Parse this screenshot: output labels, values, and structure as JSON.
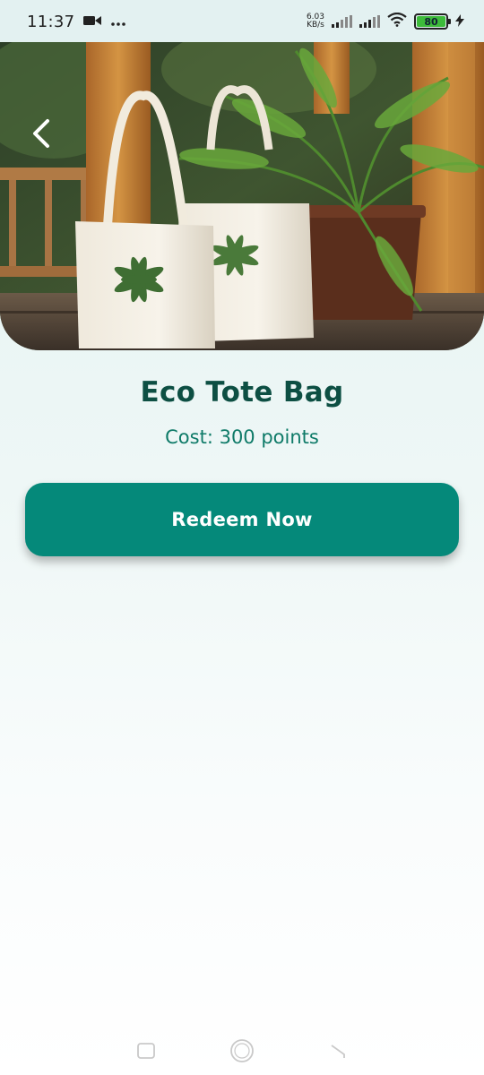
{
  "status_bar": {
    "time": "11:37",
    "net_speed_value": "6.03",
    "net_speed_unit": "KB/s",
    "battery_level": "80",
    "icons": [
      "video-camera-icon",
      "more-dots-icon",
      "signal-icon",
      "signal-icon",
      "wifi-icon",
      "battery-icon",
      "charging-icon"
    ]
  },
  "hero": {
    "image_subject": "eco-tote-bag-photo",
    "back_icon": "chevron-left-icon"
  },
  "product": {
    "title": "Eco Tote Bag",
    "cost": "Cost: 300 points"
  },
  "actions": {
    "redeem_label": "Redeem Now"
  },
  "nav_bar": {
    "icons": [
      "recent-apps-icon",
      "home-icon",
      "back-icon"
    ]
  },
  "colors": {
    "title": "#0d4f43",
    "cost": "#0e7a68",
    "button": "#05897a",
    "button_text": "#ffffff",
    "background_top": "#e3f2f1",
    "background_bottom": "#ffffff"
  }
}
